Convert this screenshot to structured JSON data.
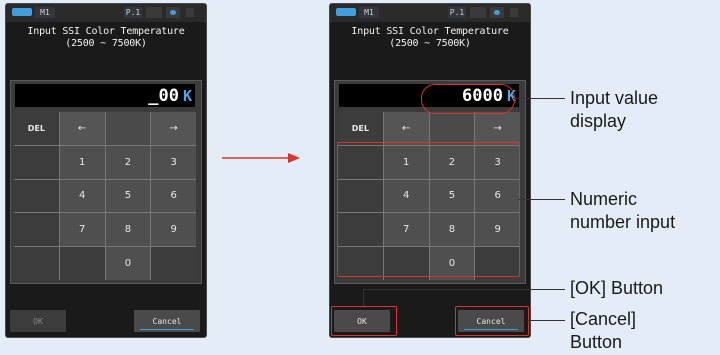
{
  "status_bar": {
    "mode": "M1",
    "page": "P.1"
  },
  "screen": {
    "title_line1": "Input SSI Color Temperature",
    "title_line2": "(2500 ~ 7500K)",
    "unit": "K"
  },
  "before": {
    "display_value": "_00"
  },
  "after": {
    "display_value": "6000",
    "display_value_cursor_digit": "0"
  },
  "keypad": {
    "del": "DEL",
    "left": "←",
    "right": "→",
    "digits": [
      "1",
      "2",
      "3",
      "4",
      "5",
      "6",
      "7",
      "8",
      "9",
      "0"
    ]
  },
  "buttons": {
    "ok": "OK",
    "cancel": "Cancel"
  },
  "annotations": {
    "input_value_line1": "Input value",
    "input_value_line2": "display",
    "numeric_line1": "Numeric",
    "numeric_line2": "number input",
    "ok_button": "[OK] Button",
    "cancel_line1": "[Cancel]",
    "cancel_line2": "Button"
  },
  "colors": {
    "accent": "#3fa0dd",
    "callout": "#d9342c",
    "arrow": "#d9342c",
    "background": "#e4edf7"
  }
}
